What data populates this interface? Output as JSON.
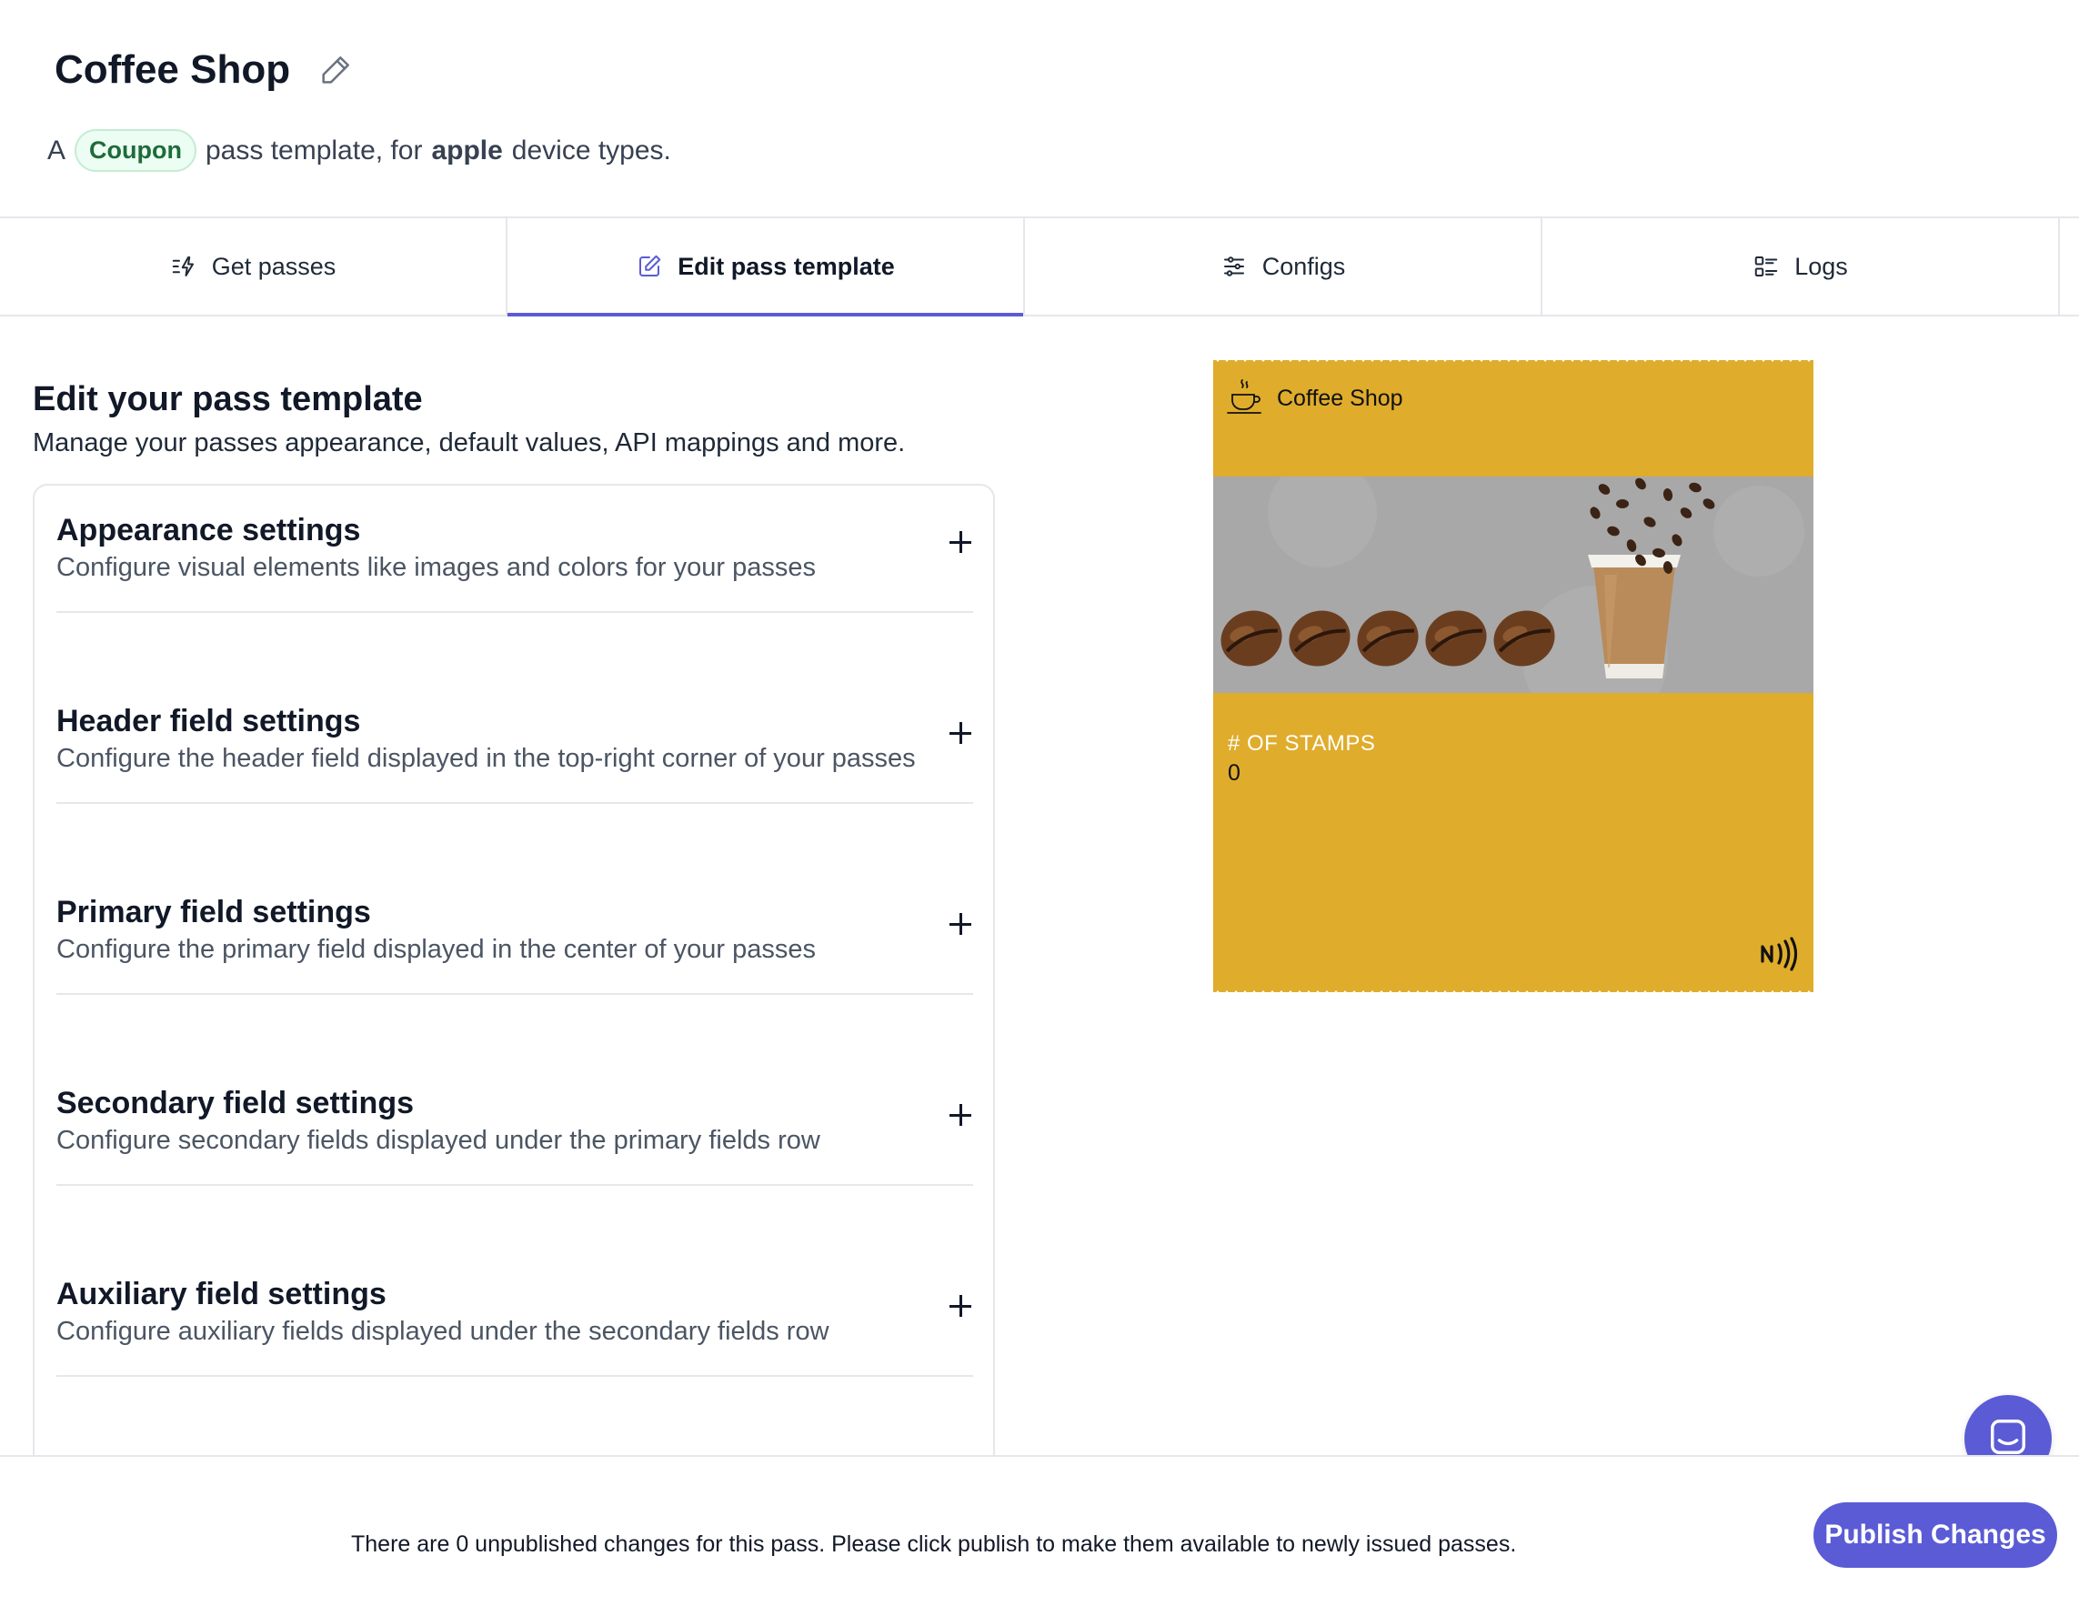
{
  "header": {
    "title": "Coffee Shop",
    "subtitle_prefix": "A",
    "pass_type": "Coupon",
    "subtitle_middle": "pass template, for",
    "device": "apple",
    "subtitle_suffix": "device types."
  },
  "tabs": [
    {
      "label": "Get passes",
      "icon": "get-passes-icon",
      "active": false
    },
    {
      "label": "Edit pass template",
      "icon": "edit-icon",
      "active": true
    },
    {
      "label": "Configs",
      "icon": "sliders-icon",
      "active": false
    },
    {
      "label": "Logs",
      "icon": "logs-icon",
      "active": false
    }
  ],
  "section": {
    "title": "Edit your pass template",
    "description": "Manage your passes appearance, default values, API mappings and more."
  },
  "settings": [
    {
      "title": "Appearance settings",
      "description": "Configure visual elements like images and colors for your passes"
    },
    {
      "title": "Header field settings",
      "description": "Configure the header field displayed in the top-right corner of your passes"
    },
    {
      "title": "Primary field settings",
      "description": "Configure the primary field displayed in the center of your passes"
    },
    {
      "title": "Secondary field settings",
      "description": "Configure secondary fields displayed under the primary fields row"
    },
    {
      "title": "Auxiliary field settings",
      "description": "Configure auxiliary fields displayed under the secondary fields row"
    }
  ],
  "pass_preview": {
    "name": "Coffee Shop",
    "background_color": "#dfac2c",
    "field_label": "# OF STAMPS",
    "field_value": "0",
    "logo_icon": "coffee-cup-icon",
    "nfc_icon": "nfc-icon"
  },
  "footer": {
    "message": "There are 0 unpublished changes for this pass. Please click publish to make them available to newly issued passes.",
    "publish_label": "Publish Changes"
  },
  "colors": {
    "accent": "#5b5bd6",
    "badge_bg": "#ecfdf3",
    "badge_text": "#1e6b39"
  }
}
